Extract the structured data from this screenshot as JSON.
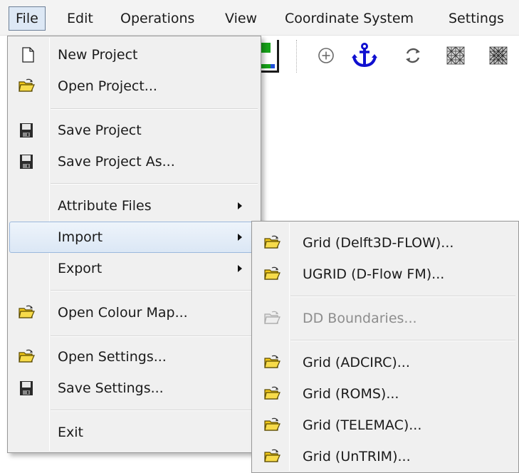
{
  "menubar": {
    "items": [
      {
        "label": "File"
      },
      {
        "label": "Edit"
      },
      {
        "label": "Operations"
      },
      {
        "label": "View"
      },
      {
        "label": "Coordinate System"
      },
      {
        "label": "Settings"
      }
    ]
  },
  "toolbar": {
    "icons": [
      "map-legend-icon",
      "zoom-in-icon",
      "anchor-icon",
      "refresh-icon",
      "grid-pattern-icon",
      "grid-pattern-icon"
    ],
    "anchor_color": "#1010d0"
  },
  "file_menu": {
    "items": [
      {
        "label": "New Project",
        "icon": "new-document-icon"
      },
      {
        "label": "Open Project...",
        "icon": "open-folder-icon"
      },
      {
        "label": "Save Project",
        "icon": "floppy-disk-icon"
      },
      {
        "label": "Save Project As...",
        "icon": "floppy-disk-icon"
      },
      {
        "label": "Attribute Files",
        "submenu": true
      },
      {
        "label": "Import",
        "submenu": true,
        "highlighted": true
      },
      {
        "label": "Export",
        "submenu": true
      },
      {
        "label": "Open Colour Map...",
        "icon": "open-folder-icon"
      },
      {
        "label": "Open Settings...",
        "icon": "open-folder-icon"
      },
      {
        "label": "Save Settings...",
        "icon": "floppy-disk-icon"
      },
      {
        "label": "Exit"
      }
    ]
  },
  "import_submenu": {
    "items": [
      {
        "label": "Grid (Delft3D-FLOW)...",
        "icon": "open-folder-icon"
      },
      {
        "label": "UGRID (D-Flow FM)...",
        "icon": "open-folder-icon"
      },
      {
        "label": "DD Boundaries...",
        "icon": "open-folder-icon",
        "disabled": true
      },
      {
        "label": "Grid (ADCIRC)...",
        "icon": "open-folder-icon"
      },
      {
        "label": "Grid (ROMS)...",
        "icon": "open-folder-icon"
      },
      {
        "label": "Grid (TELEMAC)...",
        "icon": "open-folder-icon"
      },
      {
        "label": "Grid (UnTRIM)...",
        "icon": "open-folder-icon"
      }
    ]
  },
  "colors": {
    "menu_bg": "#f0f0f0",
    "highlight": "#dbe7f5",
    "folder_yellow": "#f2c818",
    "disabled_text": "#8d8d8d"
  }
}
